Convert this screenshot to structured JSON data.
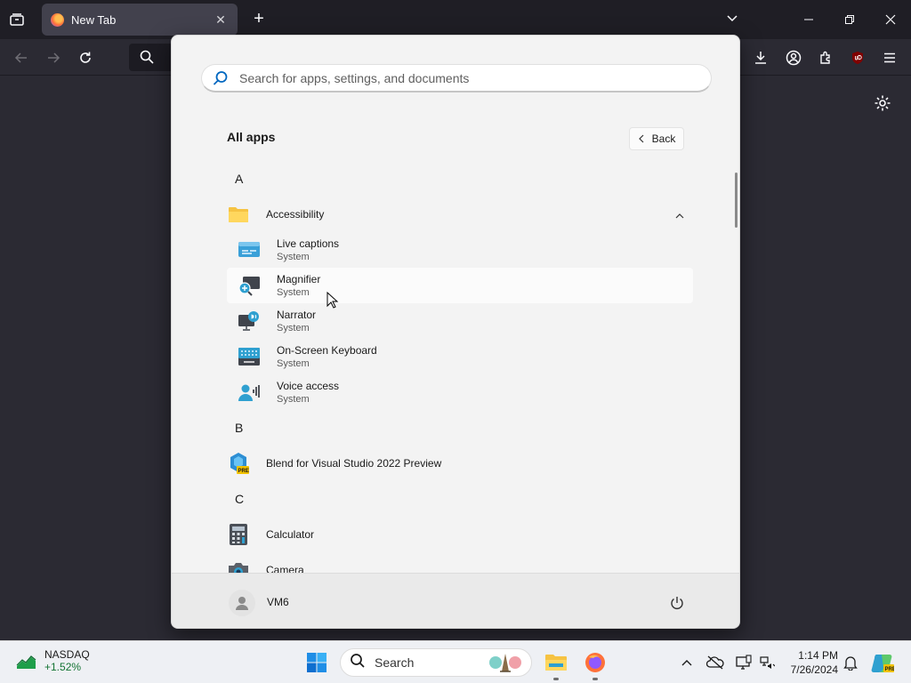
{
  "browser": {
    "tab_title": "New Tab",
    "new_tab_symbol": "+",
    "close_symbol": "✕"
  },
  "start_menu": {
    "search_placeholder": "Search for apps, settings, and documents",
    "section_title": "All apps",
    "back_label": "Back",
    "groups": [
      {
        "letter": "A"
      },
      {
        "letter": "B"
      },
      {
        "letter": "C"
      }
    ],
    "folder": {
      "name": "Accessibility",
      "expanded": true
    },
    "accessibility_apps": [
      {
        "name": "Live captions",
        "publisher": "System",
        "icon": "live-captions-icon"
      },
      {
        "name": "Magnifier",
        "publisher": "System",
        "icon": "magnifier-icon"
      },
      {
        "name": "Narrator",
        "publisher": "System",
        "icon": "narrator-icon"
      },
      {
        "name": "On-Screen Keyboard",
        "publisher": "System",
        "icon": "keyboard-icon"
      },
      {
        "name": "Voice access",
        "publisher": "System",
        "icon": "voice-access-icon"
      }
    ],
    "apps_b": [
      {
        "name": "Blend for Visual Studio 2022 Preview",
        "icon": "blend-icon"
      }
    ],
    "apps_c": [
      {
        "name": "Calculator",
        "icon": "calculator-icon"
      },
      {
        "name": "Camera",
        "icon": "camera-icon"
      }
    ],
    "user_name": "VM6"
  },
  "taskbar": {
    "stock_ticker": "NASDAQ",
    "stock_change": "+1.52%",
    "search_label": "Search",
    "time": "1:14 PM",
    "date": "7/26/2024"
  },
  "colors": {
    "accent": "#0067c0",
    "browser_dark": "#2b2a33",
    "start_bg": "#f3f3f3"
  }
}
